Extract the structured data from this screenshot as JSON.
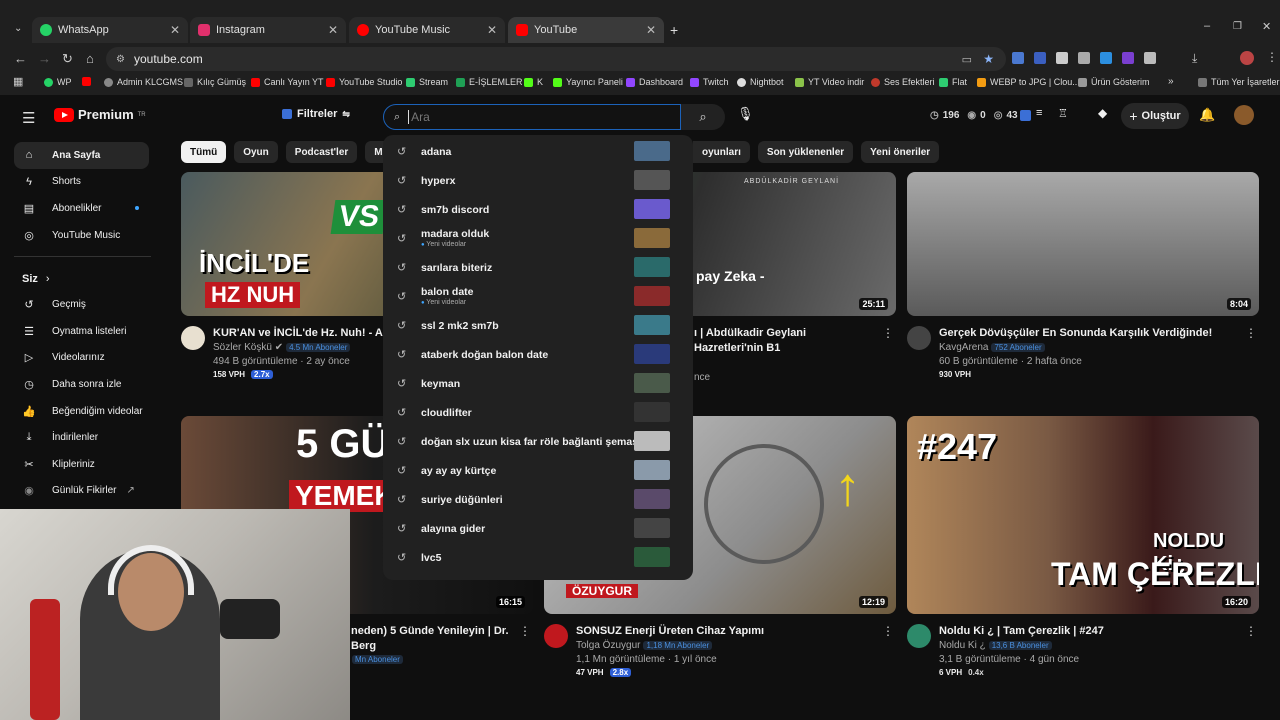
{
  "browser": {
    "tabs": [
      {
        "title": "WhatsApp",
        "color": "#25d366"
      },
      {
        "title": "Instagram",
        "color": "#e1306c"
      },
      {
        "title": "YouTube Music",
        "color": "#ff0000"
      },
      {
        "title": "YouTube",
        "color": "#ff0000"
      }
    ],
    "url": "youtube.com",
    "bookmarks": [
      "WP",
      "Admin KLCGMS",
      "Kılıç Gümüş",
      "Canlı Yayın YT",
      "YouTube Studio",
      "Stream",
      "E-İŞLEMLER",
      "K",
      "Yayıncı Paneli",
      "Dashboard",
      "Twitch",
      "Nightbot",
      "YT Video indir",
      "Ses Efektleri",
      "Flat",
      "WEBP to JPG | Clou...",
      "Ürün Gösterim",
      "Tüm Yer İşaretleri"
    ]
  },
  "header": {
    "logo": "Premium",
    "logo_region": "TR",
    "filters_label": "Filtreler",
    "search_placeholder": "Ara",
    "stat1": "196",
    "stat2": "0",
    "stat3": "43",
    "create_label": "Oluştur"
  },
  "sidebar": {
    "main": [
      "Ana Sayfa",
      "Shorts",
      "Abonelikler",
      "YouTube Music"
    ],
    "you_title": "Siz",
    "you": [
      "Geçmiş",
      "Oynatma listeleri",
      "Videolarınız",
      "Daha sonra izle",
      "Beğendiğim videolar",
      "İndirilenler",
      "Klipleriniz",
      "Günlük Fikirler"
    ]
  },
  "chips": {
    "left": [
      "Tümü",
      "Oyun",
      "Podcast'ler",
      "Müzik"
    ],
    "right": [
      "oyunları",
      "Son yüklenenler",
      "Yeni öneriler"
    ]
  },
  "suggestions": [
    {
      "text": "adana",
      "sub": ""
    },
    {
      "text": "hyperx",
      "sub": ""
    },
    {
      "text": "sm7b discord",
      "sub": ""
    },
    {
      "text": "madara olduk",
      "sub": "Yeni videolar"
    },
    {
      "text": "sarılara biteriz",
      "sub": ""
    },
    {
      "text": "balon date",
      "sub": "Yeni videolar"
    },
    {
      "text": "ssl 2 mk2 sm7b",
      "sub": ""
    },
    {
      "text": "ataberk doğan balon date",
      "sub": ""
    },
    {
      "text": "keyman",
      "sub": ""
    },
    {
      "text": "cloudlifter",
      "sub": ""
    },
    {
      "text": "doğan slx uzun kisa far röle bağlanti şemasi",
      "sub": ""
    },
    {
      "text": "ay ay ay kürtçe",
      "sub": ""
    },
    {
      "text": "suriye düğünleri",
      "sub": ""
    },
    {
      "text": "alayına gider",
      "sub": ""
    },
    {
      "text": "lvc5",
      "sub": ""
    }
  ],
  "videos": [
    {
      "title": "KUR'AN ve İNCİL'de Hz. Nuh! - Akıla",
      "channel": "Sözler Köşkü",
      "subs": "4.5 Mn Aboneler",
      "stats": "494 B görüntüleme · 2 ay önce",
      "vph": "158 VPH",
      "ratio": "2.7x",
      "overlay1": "İNCİL'DE",
      "overlay2": "HZ NUH",
      "overlay3": "VS",
      "duration": ""
    },
    {
      "title": "ı | Abdülkadir Geylani Hazretleri'nin B1",
      "channel": "",
      "subs": "",
      "stats": "nce",
      "vph": "",
      "ratio": "",
      "overlay1": "ABDÜLKADİR GEYLANİ",
      "overlay2": "pay Zeka -",
      "overlay3": "",
      "duration": "25:11"
    },
    {
      "title": "Gerçek Dövüşçüler En Sonunda Karşılık Verdiğinde!",
      "channel": "KavgArena",
      "subs": "752 Aboneler",
      "stats": "60 B görüntüleme · 2 hafta önce",
      "vph": "930 VPH",
      "ratio": "",
      "overlay1": "",
      "overlay2": "",
      "overlay3": "",
      "duration": "8:04"
    },
    {
      "title": "neden) 5 Günde Yenileyin | Dr. Berg",
      "channel": "",
      "subs": "Mn Aboneler",
      "stats": "",
      "vph": "",
      "ratio": "",
      "overlay1": "5 GÜ",
      "overlay2": "YEMEK",
      "overlay3": "",
      "duration": "16:15"
    },
    {
      "title": "SONSUZ Enerji Üreten Cihaz Yapımı",
      "channel": "Tolga Özuygur",
      "subs": "1,18 Mn Aboneler",
      "stats": "1,1 Mn görüntüleme · 1 yıl önce",
      "vph": "47 VPH",
      "ratio": "2.8x",
      "overlay1": "ÖZUYGUR",
      "overlay2": "",
      "overlay3": "",
      "duration": "12:19"
    },
    {
      "title": "Noldu Ki ¿ | Tam Çerezlik | #247",
      "channel": "Noldu Ki ¿",
      "subs": "13,6 B Aboneler",
      "stats": "3,1 B görüntüleme · 4 gün önce",
      "vph": "6 VPH",
      "ratio": "0.4x",
      "overlay1": "#247",
      "overlay2": "NOLDU Ki¿",
      "overlay3": "TAM ÇEREZLIK",
      "duration": "16:20"
    }
  ],
  "colors": {
    "accent": "#ff0000",
    "search_border": "#1c62b9",
    "ratio_badge": "#2e5fd6"
  }
}
